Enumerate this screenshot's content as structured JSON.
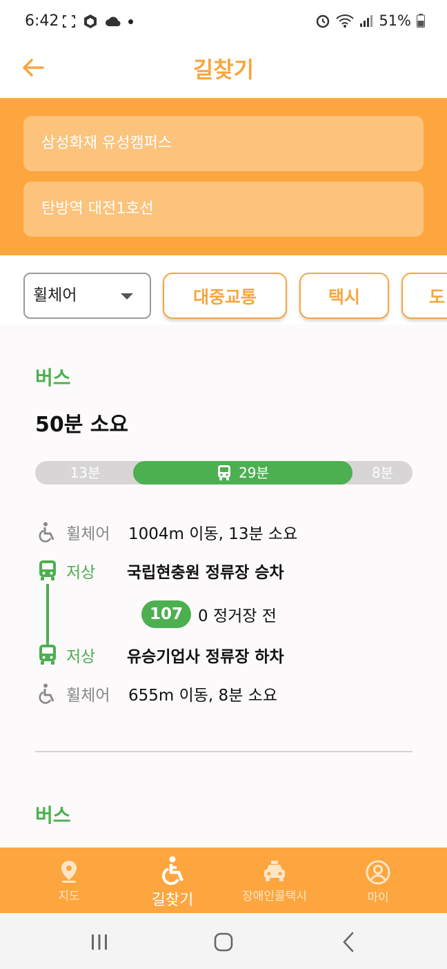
{
  "status_bar": {
    "time": "6:42",
    "battery": "51%"
  },
  "header": {
    "title": "길찾기",
    "back_icon": "arrow-left-icon"
  },
  "search": {
    "origin": "삼성화재 유성캠퍼스",
    "destination": "탄방역 대전1호선"
  },
  "filters": {
    "mode_selected": "휠체어",
    "tabs": [
      {
        "label": "대중교통"
      },
      {
        "label": "택시"
      },
      {
        "label": "도"
      }
    ]
  },
  "routes": [
    {
      "type": "버스",
      "total_time": "50분 소요",
      "timeline": {
        "walk_start": "13분",
        "bus": "29분",
        "walk_end": "8분",
        "shares": [
          13,
          29,
          8
        ]
      },
      "steps": [
        {
          "tag": "휠체어",
          "text": "1004m 이동,  13분 소요",
          "icon": "wheelchair-icon"
        },
        {
          "tag": "저상",
          "text": "국립현충원 정류장 승차",
          "icon": "bus-icon"
        },
        {
          "tag": "저상",
          "text": "유승기업사 정류장 하차",
          "icon": "bus-icon"
        },
        {
          "tag": "휠체어",
          "text": "655m 이동,  8분 소요",
          "icon": "wheelchair-icon"
        }
      ],
      "bus": {
        "number": "107",
        "stops": "0 정거장 전"
      }
    },
    {
      "type": "버스"
    }
  ],
  "bottom_nav": [
    {
      "label": "지도",
      "icon": "map-pin-icon"
    },
    {
      "label": "길찾기",
      "icon": "wheelchair-active-icon"
    },
    {
      "label": "장애인콜택시",
      "icon": "taxi-icon"
    },
    {
      "label": "마이",
      "icon": "user-circle-icon"
    }
  ],
  "colors": {
    "accent": "#fda640",
    "field": "#fcc37c",
    "green": "#4caf50",
    "title": "#f7a640"
  }
}
